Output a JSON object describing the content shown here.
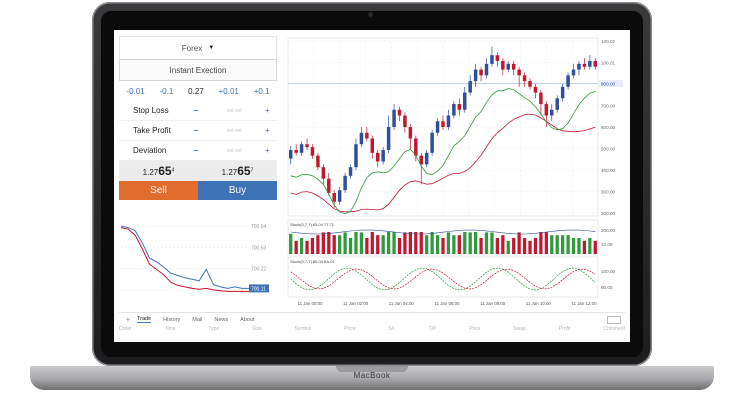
{
  "device": {
    "label": "MacBook"
  },
  "order": {
    "symbol": "Forex",
    "execution": "Instant Exection",
    "volume": {
      "minus_big": "-0.01",
      "minus_small": "-0.1",
      "current": "0.27",
      "plus_small": "+0.01",
      "plus_big": "+0.1"
    },
    "params": [
      {
        "label": "Stop Loss",
        "value": "not set"
      },
      {
        "label": "Take Profit",
        "value": "not set"
      },
      {
        "label": "Deviation",
        "value": "not set"
      }
    ],
    "bid": {
      "main": "1.27",
      "big": "65",
      "sup": "4"
    },
    "ask": {
      "main": "1.27",
      "big": "65",
      "sup": "7"
    },
    "sell_label": "Sell",
    "buy_label": "Buy"
  },
  "mini_chart": {
    "labels": [
      "700.64",
      "700.53",
      "700.22",
      "700.11"
    ],
    "series_blue": [
      0.92,
      0.9,
      0.86,
      0.7,
      0.5,
      0.45,
      0.38,
      0.3,
      0.27,
      0.24,
      0.22,
      0.2,
      0.35,
      0.15,
      0.12,
      0.1,
      0.12,
      0.1,
      0.1
    ],
    "series_red": [
      0.9,
      0.88,
      0.8,
      0.62,
      0.42,
      0.35,
      0.28,
      0.18,
      0.14,
      0.12,
      0.1,
      0.09,
      0.1,
      0.08,
      0.07,
      0.06,
      0.06,
      0.06,
      0.06
    ],
    "colors": {
      "blue": "#3e73b8",
      "red": "#c0192f"
    }
  },
  "chart_data": {
    "type": "candlestick",
    "price_ticks": [
      "100.02",
      "100.01",
      "800.00",
      "700.00",
      "600.00",
      "500.00",
      "400.00",
      "300.00",
      "200.00"
    ],
    "current_price": "800.00",
    "x_ticks": [
      "11 Jan 00:00",
      "11 Jan 02:00",
      "11 Jan 04:00",
      "11 Jan 06:00",
      "11 Jan 08:00",
      "11 Jan 10:00",
      "11 Jan 12:00"
    ],
    "candles": [
      [
        450,
        480,
        430,
        495
      ],
      [
        480,
        470,
        460,
        500
      ],
      [
        470,
        500,
        460,
        510
      ],
      [
        500,
        490,
        480,
        520
      ],
      [
        490,
        460,
        450,
        500
      ],
      [
        460,
        420,
        410,
        470
      ],
      [
        420,
        380,
        360,
        430
      ],
      [
        380,
        330,
        320,
        400
      ],
      [
        330,
        300,
        280,
        340
      ],
      [
        300,
        340,
        290,
        350
      ],
      [
        340,
        390,
        330,
        400
      ],
      [
        390,
        420,
        380,
        430
      ],
      [
        420,
        500,
        410,
        520
      ],
      [
        500,
        540,
        490,
        560
      ],
      [
        540,
        520,
        510,
        560
      ],
      [
        520,
        470,
        450,
        530
      ],
      [
        470,
        440,
        420,
        480
      ],
      [
        440,
        480,
        430,
        490
      ],
      [
        480,
        560,
        470,
        600
      ],
      [
        560,
        620,
        550,
        640
      ],
      [
        620,
        600,
        580,
        630
      ],
      [
        600,
        560,
        540,
        610
      ],
      [
        560,
        520,
        480,
        570
      ],
      [
        520,
        460,
        440,
        530
      ],
      [
        460,
        430,
        360,
        470
      ],
      [
        430,
        470,
        420,
        480
      ],
      [
        470,
        540,
        460,
        550
      ],
      [
        540,
        580,
        530,
        590
      ],
      [
        580,
        560,
        550,
        600
      ],
      [
        560,
        600,
        550,
        620
      ],
      [
        600,
        640,
        590,
        650
      ],
      [
        640,
        620,
        600,
        660
      ],
      [
        620,
        680,
        610,
        700
      ],
      [
        680,
        720,
        670,
        740
      ],
      [
        720,
        760,
        700,
        780
      ],
      [
        760,
        740,
        720,
        770
      ],
      [
        740,
        780,
        730,
        800
      ],
      [
        780,
        810,
        770,
        840
      ],
      [
        810,
        790,
        770,
        820
      ],
      [
        790,
        760,
        740,
        800
      ],
      [
        760,
        780,
        750,
        790
      ],
      [
        780,
        760,
        740,
        790
      ],
      [
        760,
        740,
        700,
        770
      ],
      [
        740,
        720,
        700,
        750
      ],
      [
        720,
        700,
        690,
        730
      ],
      [
        700,
        680,
        660,
        710
      ],
      [
        680,
        640,
        600,
        690
      ],
      [
        640,
        600,
        560,
        650
      ],
      [
        600,
        620,
        580,
        640
      ],
      [
        620,
        660,
        610,
        670
      ],
      [
        660,
        700,
        650,
        710
      ],
      [
        700,
        740,
        690,
        750
      ],
      [
        740,
        760,
        730,
        780
      ],
      [
        760,
        780,
        740,
        790
      ],
      [
        780,
        770,
        760,
        800
      ],
      [
        770,
        790,
        760,
        810
      ],
      [
        790,
        770,
        760,
        800
      ]
    ],
    "colors": {
      "up": "#2f4f9a",
      "down": "#c0192f",
      "ma_fast": "#c0192f",
      "ma_slow": "#2f9a3c",
      "stoch_main": "#2f9a3c",
      "stoch_signal": "#c0192f"
    },
    "indicator1_label": "Stoch(5,7,7) 65.04 77.71",
    "indicator2_label": "Stoch(5,7,7) 85.04 AA.01",
    "indicator_ticks1": [
      "200.00",
      "10.09"
    ],
    "indicator_ticks2": [
      "100.00",
      "80.00"
    ]
  },
  "bottom": {
    "tabs": [
      "Trade",
      "History",
      "Mail",
      "News",
      "About"
    ],
    "columns": [
      "Order",
      "Time",
      "Type",
      "Size",
      "Symbol",
      "Price",
      "S/L",
      "T/P",
      "Price",
      "Swap",
      "Profit",
      "Comment"
    ]
  }
}
